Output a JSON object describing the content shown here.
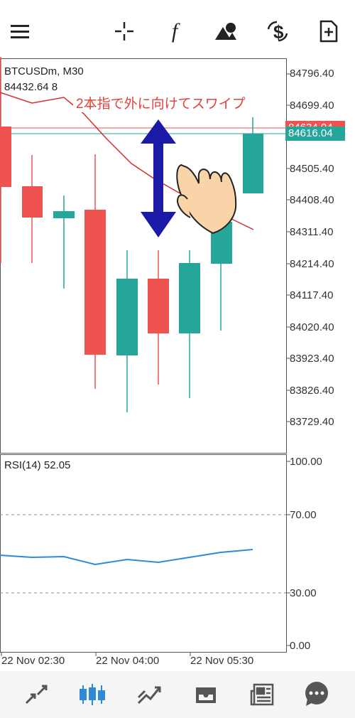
{
  "toolbar": {
    "icons": [
      "menu-icon",
      "crosshair-icon",
      "function-icon",
      "objects-icon",
      "price-change-icon",
      "new-order-icon"
    ],
    "function_glyph": "f"
  },
  "chart": {
    "symbol": "BTCUSDm, M30",
    "ohlc": "84432.64 8",
    "annotation": "2本指で外に向けてスワイプ",
    "price_axis": [
      "84796.40",
      "84699.40",
      "84505.40",
      "84408.40",
      "84311.40",
      "84214.40",
      "84117.40",
      "84020.40",
      "83923.40",
      "83826.40",
      "83729.40"
    ],
    "ask_tag": "84634.04",
    "bid_tag": "84616.04",
    "colors": {
      "bull": "#26a69a",
      "bear": "#ef5350",
      "ma": "#d32f2f",
      "annotation": "#e0413b",
      "arrow": "#1a1aa6"
    }
  },
  "rsi": {
    "label": "RSI(14) 52.05",
    "levels": [
      "100.00",
      "70.00",
      "30.00",
      "0.00"
    ],
    "color": "#2e8ad8"
  },
  "time_axis": [
    "22 Nov 02:30",
    "22 Nov 04:00",
    "22 Nov 05:30"
  ],
  "bottom_nav": {
    "items": [
      "quotes-icon",
      "chart-icon",
      "trade-icon",
      "history-icon",
      "news-icon",
      "chat-icon"
    ],
    "active": "chart-icon"
  }
}
